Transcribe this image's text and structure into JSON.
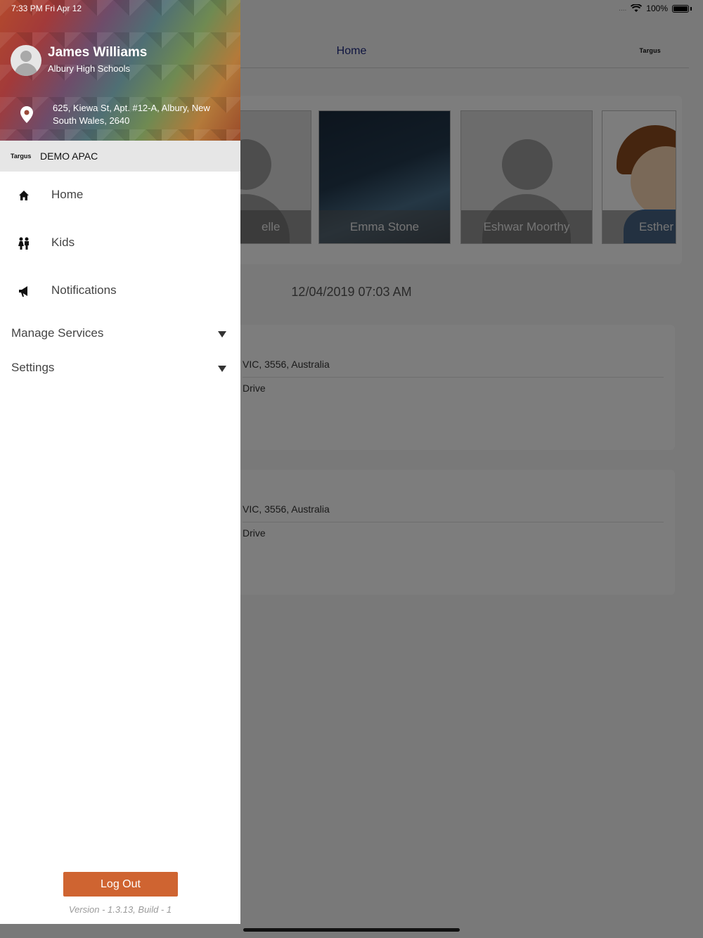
{
  "status_bar": {
    "time": "7:33 PM   Fri Apr 12",
    "signal": "....",
    "battery": "100%"
  },
  "nav": {
    "title": "Home",
    "logo": "Targus"
  },
  "kids": [
    {
      "name": "Michelle Piper",
      "visible_name": "elle Piper"
    },
    {
      "name": "Emma Stone"
    },
    {
      "name": "Eshwar Moorthy"
    },
    {
      "name": "Esther"
    }
  ],
  "main": {
    "date": "12/04/2019 07:03 AM",
    "trips": [
      {
        "address": "VIC, 3556, Australia",
        "detail": "Drive"
      },
      {
        "address": "VIC, 3556, Australia",
        "detail": "Drive"
      }
    ]
  },
  "drawer": {
    "profile": {
      "name": "James Williams",
      "school": "Albury High Schools",
      "address": "625, Kiewa St,  Apt. #12-A,  Albury,  New South Wales,  2640"
    },
    "org": {
      "logo": "Targus",
      "name": "DEMO APAC"
    },
    "menu": [
      {
        "label": "Home",
        "icon": "home-icon"
      },
      {
        "label": "Kids",
        "icon": "kids-icon"
      },
      {
        "label": "Notifications",
        "icon": "megaphone-icon"
      }
    ],
    "sections": [
      {
        "label": "Manage Services"
      },
      {
        "label": "Settings"
      }
    ],
    "logout_label": "Log Out",
    "version": "Version - 1.3.13, Build - 1",
    "accent_color": "#cf6431"
  }
}
